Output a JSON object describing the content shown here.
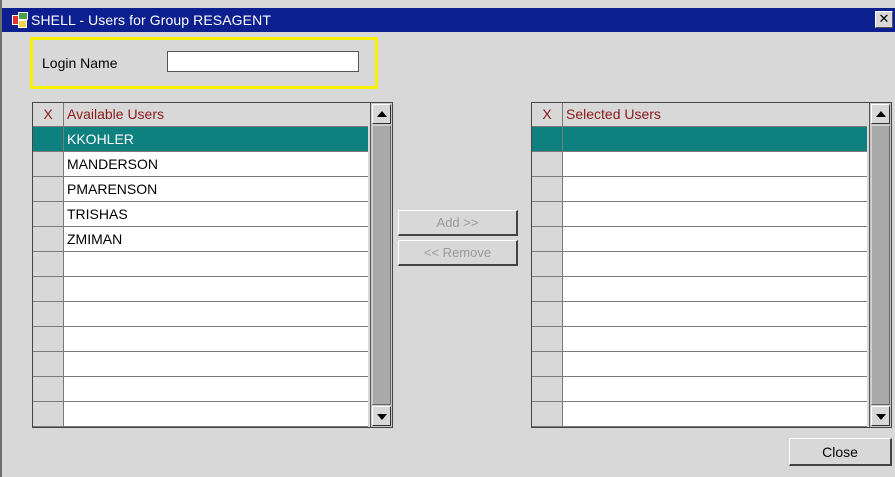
{
  "window": {
    "title": "SHELL - Users for Group RESAGENT",
    "close_glyph": "✕",
    "icon": "app-icon"
  },
  "login": {
    "label": "Login Name",
    "value": ""
  },
  "available": {
    "x_header": "X",
    "header": "Available Users",
    "rows": [
      "KKOHLER",
      "MANDERSON",
      "PMARENSON",
      "TRISHAS",
      "ZMIMAN",
      "",
      "",
      "",
      "",
      "",
      "",
      ""
    ],
    "selected_index": 0
  },
  "selected_users": {
    "x_header": "X",
    "header": "Selected Users",
    "rows": [
      "",
      "",
      "",
      "",
      "",
      "",
      "",
      "",
      "",
      "",
      "",
      ""
    ],
    "selected_index": 0
  },
  "buttons": {
    "add": "Add >>",
    "remove": "<< Remove",
    "close": "Close"
  },
  "colors": {
    "titlebar": "#0b1f8f",
    "selection": "#0f8080",
    "header_text": "#8b1a1a",
    "highlight_border": "#f7f000"
  }
}
